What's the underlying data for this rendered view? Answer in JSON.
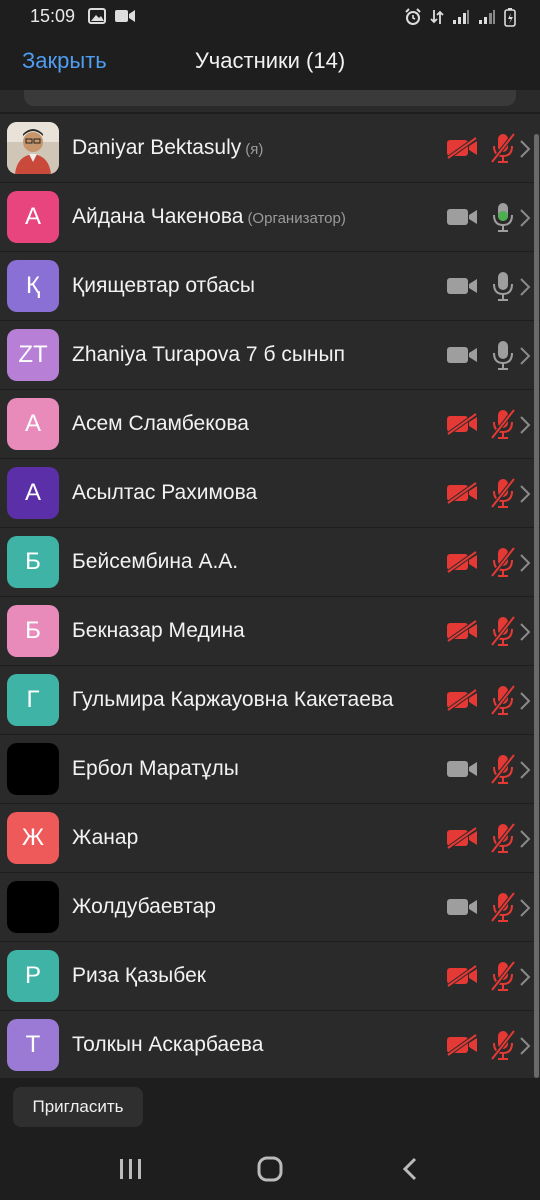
{
  "status_bar": {
    "time": "15:09"
  },
  "header": {
    "close_label": "Закрыть",
    "title": "Участники (14)"
  },
  "participants": [
    {
      "name": "Daniyar Bektasuly",
      "tag": "(я)",
      "avatar_text": "",
      "avatar_color": "#8a7a6a",
      "avatar_photo": true,
      "camera": "off",
      "mic": "muted"
    },
    {
      "name": "Айдана Чакенова",
      "tag": "(Организатор)",
      "avatar_text": "А",
      "avatar_color": "#e8457f",
      "camera": "on",
      "mic": "active"
    },
    {
      "name": "Қиящевтар отбасы",
      "tag": "",
      "avatar_text": "Қ",
      "avatar_color": "#8a6fd4",
      "camera": "on",
      "mic": "on"
    },
    {
      "name": "Zhaniya Turapova 7 б сынып",
      "tag": "",
      "avatar_text": "ZT",
      "avatar_color": "#b77fd6",
      "camera": "on",
      "mic": "on"
    },
    {
      "name": "Асем Сламбекова",
      "tag": "",
      "avatar_text": "А",
      "avatar_color": "#e88bbb",
      "camera": "off",
      "mic": "muted"
    },
    {
      "name": "Асылтас Рахимова",
      "tag": "",
      "avatar_text": "А",
      "avatar_color": "#5b2fa8",
      "camera": "off",
      "mic": "muted"
    },
    {
      "name": "Бейсембина А.А.",
      "tag": "",
      "avatar_text": "Б",
      "avatar_color": "#3fb3a6",
      "camera": "off",
      "mic": "muted"
    },
    {
      "name": "Бекназар Медина",
      "tag": "",
      "avatar_text": "Б",
      "avatar_color": "#e88bbb",
      "camera": "off",
      "mic": "muted"
    },
    {
      "name": "Гульмира Каржауовна Какетаева",
      "tag": "",
      "avatar_text": "Г",
      "avatar_color": "#3fb3a6",
      "camera": "off",
      "mic": "muted"
    },
    {
      "name": "Ербол Маратұлы",
      "tag": "",
      "avatar_text": "",
      "avatar_color": "#000000",
      "camera": "on",
      "mic": "muted"
    },
    {
      "name": "Жанар",
      "tag": "",
      "avatar_text": "Ж",
      "avatar_color": "#ee5a5a",
      "camera": "off",
      "mic": "muted"
    },
    {
      "name": "Жолдубаевтар",
      "tag": "",
      "avatar_text": "",
      "avatar_color": "#000000",
      "camera": "on",
      "mic": "muted"
    },
    {
      "name": "Риза Қазыбек",
      "tag": "",
      "avatar_text": "Р",
      "avatar_color": "#3fb3a6",
      "camera": "off",
      "mic": "muted"
    },
    {
      "name": "Толкын Аскарбаева",
      "tag": "",
      "avatar_text": "Т",
      "avatar_color": "#9a7ad4",
      "camera": "off",
      "mic": "muted"
    }
  ],
  "footer": {
    "invite_label": "Пригласить"
  },
  "colors": {
    "accent": "#4f9cf0",
    "muted_red": "#e53935",
    "mic_active": "#4caf50",
    "icon_gray": "#9e9e9e"
  },
  "icons": [
    "camera-icon",
    "camera-off-icon",
    "mic-icon",
    "mic-muted-icon",
    "chevron-right-icon",
    "recent-apps-icon",
    "home-icon",
    "back-icon"
  ]
}
